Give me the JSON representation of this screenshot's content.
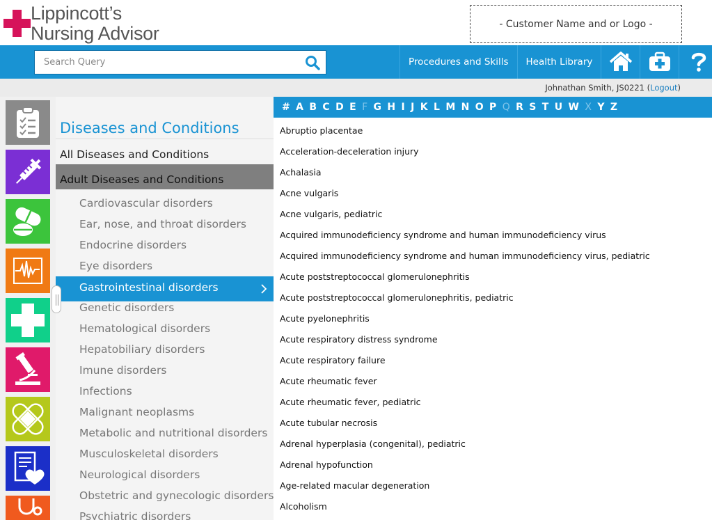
{
  "brand": {
    "line1": "Lippincott’s",
    "line2": "Nursing Advisor",
    "accent": "#d6135a"
  },
  "customer_box": "- Customer Name and or Logo -",
  "search": {
    "placeholder": "Search Query",
    "icon": "search-icon"
  },
  "nav": {
    "links": [
      "Procedures and Skills",
      "Health Library"
    ],
    "icons": [
      "home-icon",
      "first-aid-kit-icon",
      "help-icon"
    ],
    "color": "#1993d3"
  },
  "user": {
    "text": "Johnathan Smith, JS0221 (",
    "logout": "Logout",
    "close": ")"
  },
  "rail": {
    "tiles": [
      {
        "icon": "clipboard-checklist-icon",
        "color": "#8a8a8a"
      },
      {
        "icon": "syringe-icon",
        "color": "#7b2fd4"
      },
      {
        "icon": "pills-icon",
        "color": "#3cc43c"
      },
      {
        "icon": "heart-monitor-icon",
        "color": "#f07a14"
      },
      {
        "icon": "medical-cross-icon",
        "color": "#10d08a"
      },
      {
        "icon": "microscope-icon",
        "color": "#e01a6a"
      },
      {
        "icon": "bandage-icon",
        "color": "#b5c81c"
      },
      {
        "icon": "document-heart-icon",
        "color": "#1b2fc8"
      },
      {
        "icon": "stethoscope-icon",
        "color": "#f05a1e"
      }
    ]
  },
  "categories": {
    "title": "Diseases and Conditions",
    "all": "All Diseases and Conditions",
    "group": "Adult Diseases and Conditions",
    "active_index": 4,
    "items": [
      "Cardiovascular disorders",
      "Ear, nose, and throat disorders",
      "Endocrine disorders",
      "Eye disorders",
      "Gastrointestinal disorders",
      "Genetic disorders",
      "Hematological disorders",
      "Hepatobiliary disorders",
      "Imune disorders",
      "Infections",
      "Malignant neoplasms",
      "Metabolic and nutritional disorders",
      "Musculoskeletal disorders",
      "Neurological disorders",
      "Obstetric and gynecologic disorders",
      "Psychiatric disorders"
    ]
  },
  "alphabet": {
    "letters": [
      "#",
      "A",
      "B",
      "C",
      "D",
      "E",
      "F",
      "G",
      "H",
      "I",
      "J",
      "K",
      "L",
      "M",
      "N",
      "O",
      "P",
      "Q",
      "R",
      "S",
      "T",
      "U",
      "W",
      "X",
      "Y",
      "Z"
    ],
    "disabled": [
      "F",
      "Q",
      "X"
    ]
  },
  "entries": [
    "Abruptio placentae",
    "Acceleration-deceleration injury",
    "Achalasia",
    "Acne vulgaris",
    "Acne vulgaris, pediatric",
    "Acquired immunodeficiency syndrome and human immunodeficiency virus",
    "Acquired immunodeficiency syndrome and human immunodeficiency virus, pediatric",
    "Acute poststreptococcal glomerulonephritis",
    "Acute poststreptococcal glomerulonephritis, pediatric",
    "Acute pyelonephritis",
    "Acute respiratory distress syndrome",
    "Acute respiratory failure",
    "Acute rheumatic fever",
    "Acute rheumatic fever, pediatric",
    "Acute tubular necrosis",
    "Adrenal hyperplasia (congenital), pediatric",
    "Adrenal hypofunction",
    "Age-related macular degeneration",
    "Alcoholism"
  ]
}
